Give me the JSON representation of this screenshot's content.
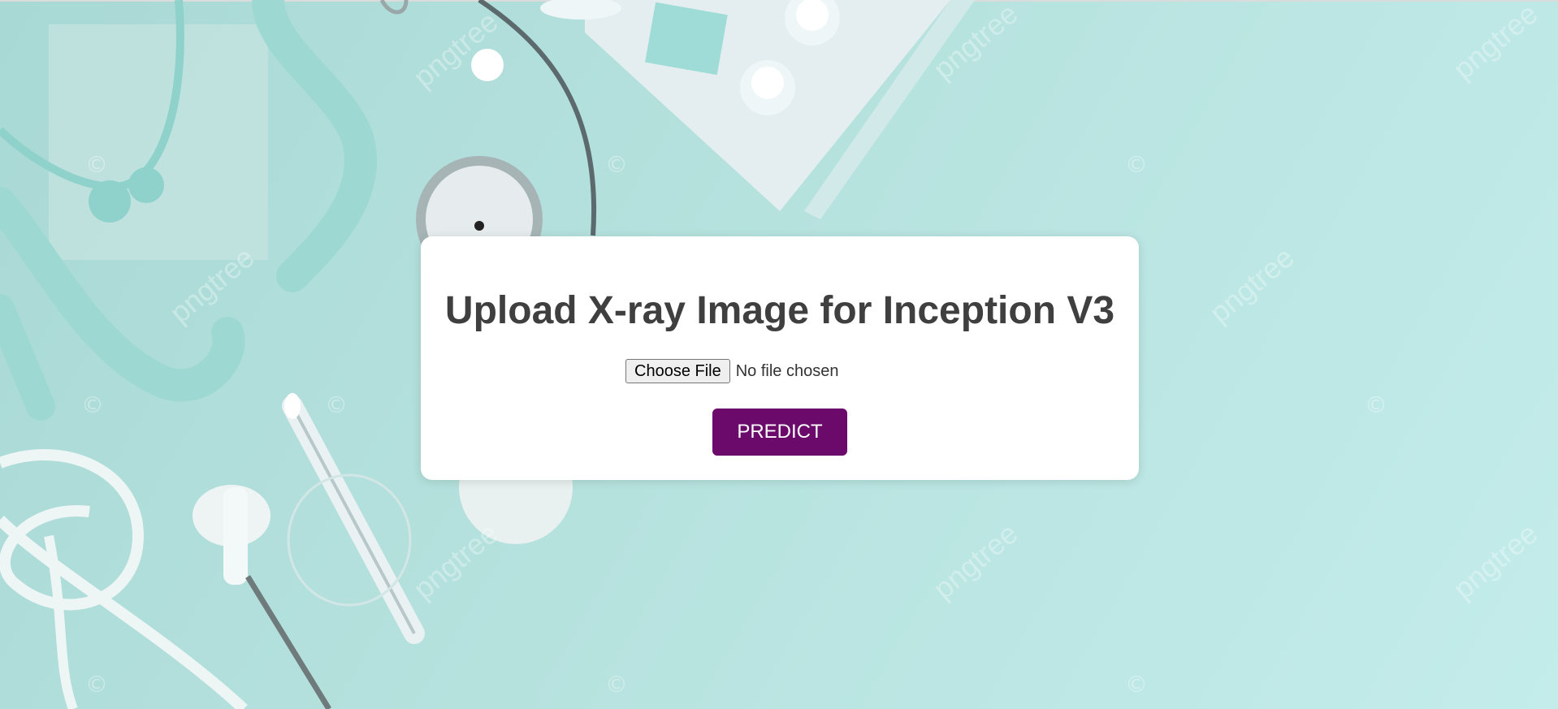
{
  "upload_card": {
    "title": "Upload X-ray Image for Inception V3",
    "file_input": {
      "button_label": "Choose File",
      "status": "No file chosen"
    },
    "predict_label": "PREDICT"
  },
  "background": {
    "watermark_text": "pngtree",
    "copyright_symbol": "©"
  },
  "colors": {
    "background": "#b6e2de",
    "card": "#ffffff",
    "title_text": "#3f3f3f",
    "predict_button": "#6b0a6a",
    "predict_text": "#ffffff"
  }
}
